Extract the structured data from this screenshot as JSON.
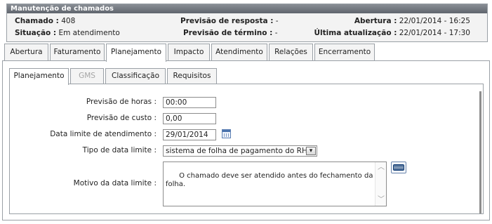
{
  "panel": {
    "title": "Manutenção de chamados",
    "chamado_label": "Chamado :",
    "chamado_value": "408",
    "previsao_resposta_label": "Previsão de resposta :",
    "previsao_resposta_value": "-",
    "abertura_label": "Abertura :",
    "abertura_value": "22/01/2014 - 16:25",
    "situacao_label": "Situação :",
    "situacao_value": "Em atendimento",
    "previsao_termino_label": "Previsão de término :",
    "previsao_termino_value": "-",
    "ultima_atualizacao_label": "Última atualização :",
    "ultima_atualizacao_value": "22/01/2014 - 17:30"
  },
  "tabs": [
    {
      "label": "Abertura"
    },
    {
      "label": "Faturamento"
    },
    {
      "label": "Planejamento"
    },
    {
      "label": "Impacto"
    },
    {
      "label": "Atendimento"
    },
    {
      "label": "Relações"
    },
    {
      "label": "Encerramento"
    }
  ],
  "active_tab": "Planejamento",
  "subtabs": [
    {
      "label": "Planejamento"
    },
    {
      "label": "GMS"
    },
    {
      "label": "Classificação"
    },
    {
      "label": "Requisitos"
    }
  ],
  "active_subtab": "Planejamento",
  "form": {
    "previsao_horas_label": "Previsão de horas :",
    "previsao_horas_value": "00:00",
    "previsao_custo_label": "Previsão de custo :",
    "previsao_custo_value": "0,00",
    "data_limite_label": "Data limite de atendimento :",
    "data_limite_value": "29/01/2014",
    "tipo_data_label": "Tipo de data limite :",
    "tipo_data_value": "sistema de folha de pagamento do RH",
    "motivo_label": "Motivo da data limite :",
    "motivo_value": "O chamado deve ser atendido antes do fechamento da\nfolha."
  },
  "icons": {
    "calendar": "calendar-icon",
    "book": "book-icon",
    "dropdown": "chevron-down-icon"
  },
  "colors": {
    "title_bar": "#6f757c",
    "border": "#9aa0a6",
    "tab_bg": "#f4f4f4",
    "disabled_text": "#a5a5a5"
  }
}
